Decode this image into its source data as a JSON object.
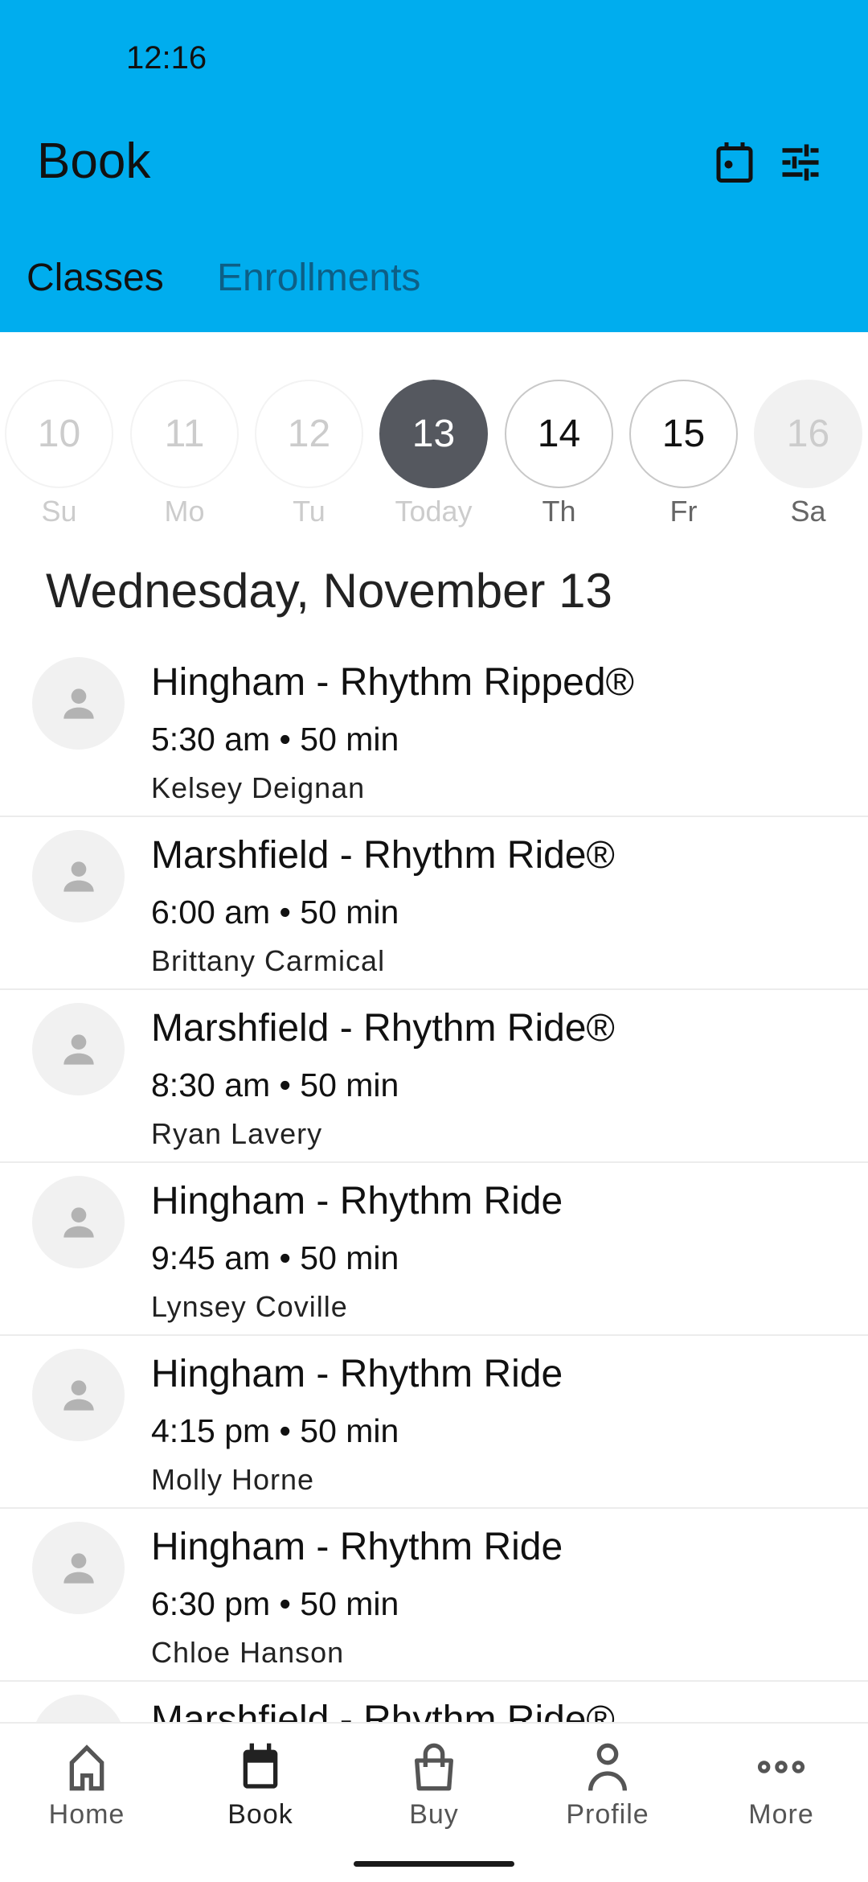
{
  "status_bar": {
    "time": "12:16"
  },
  "header": {
    "title": "Book",
    "icons": [
      "calendar-icon",
      "filter-sliders-icon"
    ],
    "bg_color": "#00adee"
  },
  "tabs": [
    {
      "label": "Classes",
      "active": true
    },
    {
      "label": "Enrollments",
      "active": false
    }
  ],
  "days": [
    {
      "num": "10",
      "label": "Su",
      "state": "past"
    },
    {
      "num": "11",
      "label": "Mo",
      "state": "past"
    },
    {
      "num": "12",
      "label": "Tu",
      "state": "past"
    },
    {
      "num": "13",
      "label": "Today",
      "state": "selected"
    },
    {
      "num": "14",
      "label": "Th",
      "state": "available"
    },
    {
      "num": "15",
      "label": "Fr",
      "state": "available"
    },
    {
      "num": "16",
      "label": "Sa",
      "state": "unavailable"
    }
  ],
  "date_heading": "Wednesday, November 13",
  "classes": [
    {
      "title": "Hingham - Rhythm Ripped®",
      "time": "5:30 am • 50 min",
      "instructor": "Kelsey Deignan"
    },
    {
      "title": "Marshfield - Rhythm Ride®",
      "time": "6:00 am • 50 min",
      "instructor": "Brittany Carmical"
    },
    {
      "title": "Marshfield - Rhythm Ride®",
      "time": "8:30 am • 50 min",
      "instructor": "Ryan Lavery"
    },
    {
      "title": "Hingham - Rhythm Ride",
      "time": "9:45 am • 50 min",
      "instructor": "Lynsey Coville"
    },
    {
      "title": "Hingham - Rhythm Ride",
      "time": "4:15 pm • 50 min",
      "instructor": "Molly Horne"
    },
    {
      "title": "Hingham - Rhythm Ride",
      "time": "6:30 pm • 50 min",
      "instructor": "Chloe Hanson"
    },
    {
      "title": "Marshfield - Rhythm Ride®",
      "time": "",
      "instructor": ""
    }
  ],
  "nav": [
    {
      "label": "Home",
      "icon": "home-icon"
    },
    {
      "label": "Book",
      "icon": "calendar-icon",
      "active": true
    },
    {
      "label": "Buy",
      "icon": "shopping-bag-icon"
    },
    {
      "label": "Profile",
      "icon": "person-icon"
    },
    {
      "label": "More",
      "icon": "more-dots-icon"
    }
  ]
}
